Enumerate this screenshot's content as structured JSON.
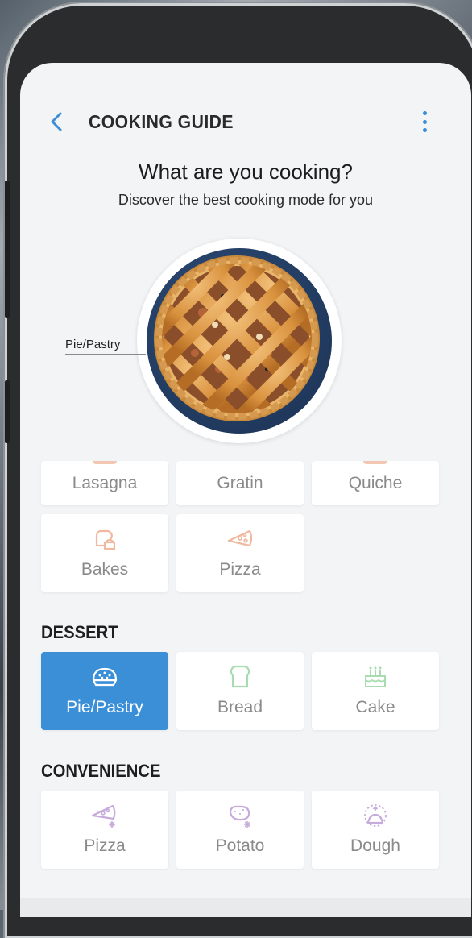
{
  "header": {
    "title": "COOKING GUIDE"
  },
  "intro": {
    "question": "What are you cooking?",
    "subtitle": "Discover the best cooking mode for you"
  },
  "hero": {
    "label": "Pie/Pastry"
  },
  "top_grid": [
    {
      "label": "Lasagna"
    },
    {
      "label": "Gratin"
    },
    {
      "label": "Quiche"
    },
    {
      "label": "Bakes",
      "icon": "bread-slice-icon"
    },
    {
      "label": "Pizza",
      "icon": "pizza-slice-icon"
    }
  ],
  "dessert": {
    "title": "DESSERT",
    "items": [
      {
        "label": "Pie/Pastry",
        "icon": "pie-icon",
        "selected": true
      },
      {
        "label": "Bread",
        "icon": "bread-icon"
      },
      {
        "label": "Cake",
        "icon": "cake-icon"
      }
    ]
  },
  "convenience": {
    "title": "CONVENIENCE",
    "items": [
      {
        "label": "Pizza",
        "icon": "frozen-pizza-icon"
      },
      {
        "label": "Potato",
        "icon": "frozen-potato-icon"
      },
      {
        "label": "Dough",
        "icon": "dough-icon"
      }
    ]
  },
  "colors": {
    "accent": "#3a8fd6",
    "orange_icon": "#f0b89f",
    "green_icon": "#a8dcb0",
    "purple_icon": "#c6abdb"
  }
}
